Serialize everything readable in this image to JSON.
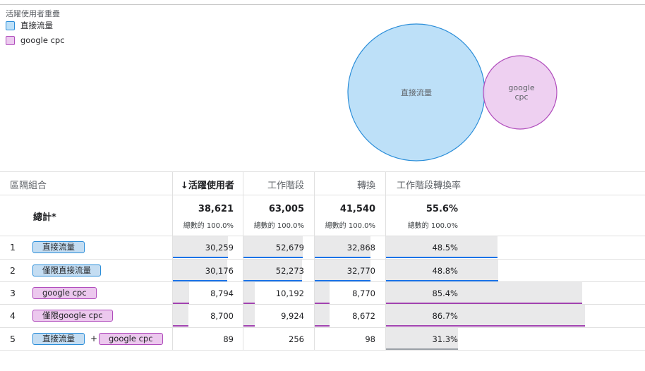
{
  "legend": {
    "title": "活躍使用者重疊",
    "items": [
      {
        "label": "直接流量",
        "fill": "#bde0f8",
        "stroke": "#2b8ed9"
      },
      {
        "label": "google cpc",
        "fill": "#eccbef",
        "stroke": "#b04cbc"
      }
    ]
  },
  "chart_data": {
    "type": "venn",
    "sets": [
      {
        "name": "直接流量",
        "value": 30259
      },
      {
        "name": "google cpc",
        "value": 8794
      }
    ],
    "overlap": {
      "sets": [
        "直接流量",
        "google cpc"
      ],
      "value": 89
    },
    "circle_labels": [
      "直接流量",
      "google cpc"
    ]
  },
  "table": {
    "headers": {
      "segment": "區隔組合",
      "active_users": "↓活躍使用者",
      "sessions": "工作階段",
      "conversions": "轉換",
      "session_conv_rate": "工作階段轉換率"
    },
    "total": {
      "label": "總計*",
      "active_users": "38,621",
      "sessions": "63,005",
      "conversions": "41,540",
      "session_conv_rate": "55.6%",
      "sub": "總數的 100.0%"
    },
    "rows": [
      {
        "index": "1",
        "chips": [
          {
            "label": "直接流量",
            "color": "blue"
          }
        ],
        "active_users": "30,259",
        "sessions": "52,679",
        "conversions": "32,868",
        "session_conv_rate": "48.5%",
        "fill": {
          "active_users": 0.7835,
          "sessions": 0.8361,
          "conversions": 0.7912,
          "session_conv_rate": 0.485
        }
      },
      {
        "index": "2",
        "chips": [
          {
            "label": "僅限直接流量",
            "color": "blue"
          }
        ],
        "active_users": "30,176",
        "sessions": "52,273",
        "conversions": "32,770",
        "session_conv_rate": "48.8%",
        "fill": {
          "active_users": 0.7813,
          "sessions": 0.8297,
          "conversions": 0.7889,
          "session_conv_rate": 0.488
        }
      },
      {
        "index": "3",
        "chips": [
          {
            "label": "google cpc",
            "color": "pink"
          }
        ],
        "active_users": "8,794",
        "sessions": "10,192",
        "conversions": "8,770",
        "session_conv_rate": "85.4%",
        "fill": {
          "active_users": 0.2277,
          "sessions": 0.1618,
          "conversions": 0.2111,
          "session_conv_rate": 0.854
        }
      },
      {
        "index": "4",
        "chips": [
          {
            "label": "僅限google cpc",
            "color": "pink"
          }
        ],
        "active_users": "8,700",
        "sessions": "9,924",
        "conversions": "8,672",
        "session_conv_rate": "86.7%",
        "fill": {
          "active_users": 0.2253,
          "sessions": 0.1575,
          "conversions": 0.2088,
          "session_conv_rate": 0.867
        }
      },
      {
        "index": "5",
        "chips": [
          {
            "label": "直接流量",
            "color": "blue"
          },
          {
            "label": "google cpc",
            "color": "pink"
          }
        ],
        "plus": "+",
        "active_users": "89",
        "sessions": "256",
        "conversions": "98",
        "session_conv_rate": "31.3%",
        "fill": {
          "active_users": 0.0023,
          "sessions": 0.0041,
          "conversions": 0.0024,
          "session_conv_rate": 0.313
        }
      }
    ],
    "colors": {
      "blue_line": "#1a73e8",
      "pink_line": "#a142b0",
      "gray_line": "#9aa0a6",
      "bar": "#e9e9ea"
    }
  }
}
